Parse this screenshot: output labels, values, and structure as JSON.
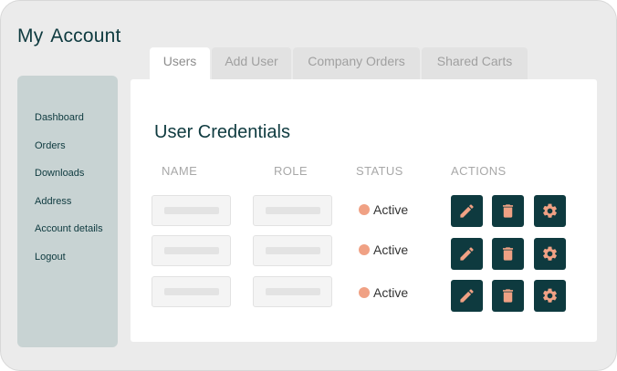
{
  "colors": {
    "accent": "#0e3a3f",
    "icon": "#f0a184",
    "status_active": "#f0a184",
    "sidebar_bg": "#c8d3d3"
  },
  "page_title": "My  Account",
  "sidebar": {
    "items": [
      {
        "label": "Dashboard"
      },
      {
        "label": "Orders"
      },
      {
        "label": "Downloads"
      },
      {
        "label": "Address"
      },
      {
        "label": "Account details"
      },
      {
        "label": "Logout"
      }
    ]
  },
  "tabs": [
    {
      "label": "Users",
      "active": true
    },
    {
      "label": "Add User",
      "active": false
    },
    {
      "label": "Company Orders",
      "active": false
    },
    {
      "label": "Shared Carts",
      "active": false
    }
  ],
  "panel": {
    "title": "User Credentials",
    "columns": [
      "NAME",
      "ROLE",
      "STATUS",
      "ACTIONS"
    ],
    "rows": [
      {
        "name": "",
        "role": "",
        "status": "Active",
        "actions": [
          "edit-icon",
          "trash-icon",
          "gear-icon"
        ]
      },
      {
        "name": "",
        "role": "",
        "status": "Active",
        "actions": [
          "edit-icon",
          "trash-icon",
          "gear-icon"
        ]
      },
      {
        "name": "",
        "role": "",
        "status": "Active",
        "actions": [
          "edit-icon",
          "trash-icon",
          "gear-icon"
        ]
      }
    ]
  }
}
